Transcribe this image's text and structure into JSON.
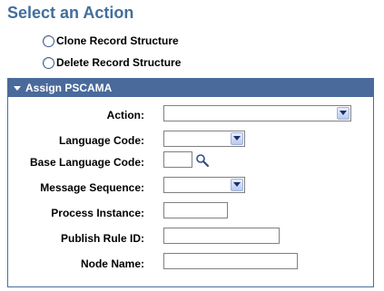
{
  "page": {
    "title": "Select an Action"
  },
  "actions": {
    "clone_label": "Clone Record Structure",
    "delete_label": "Delete Record Structure"
  },
  "panel": {
    "header": "Assign PSCAMA",
    "fields": {
      "action_label": "Action:",
      "action_value": "",
      "language_code_label": "Language Code:",
      "language_code_value": "",
      "base_language_code_label": "Base Language Code:",
      "base_language_code_value": "",
      "message_sequence_label": "Message Sequence:",
      "message_sequence_value": "",
      "process_instance_label": "Process Instance:",
      "process_instance_value": "",
      "publish_rule_id_label": "Publish Rule ID:",
      "publish_rule_id_value": "",
      "node_name_label": "Node Name:",
      "node_name_value": ""
    }
  },
  "icons": {
    "lookup": "magnifier-icon",
    "dropdown": "chevron-down-icon",
    "collapse": "triangle-down-icon"
  },
  "colors": {
    "title": "#426f9c",
    "panel_header": "#496a9a"
  }
}
